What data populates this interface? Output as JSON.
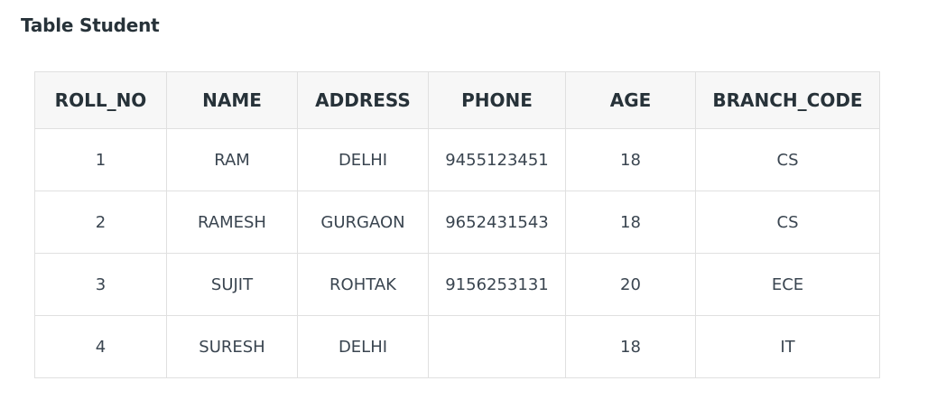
{
  "title": "Table Student",
  "table": {
    "headers": [
      "ROLL_NO",
      "NAME",
      "ADDRESS",
      "PHONE",
      "AGE",
      "BRANCH_CODE"
    ],
    "rows": [
      [
        "1",
        "RAM",
        "DELHI",
        "9455123451",
        "18",
        "CS"
      ],
      [
        "2",
        "RAMESH",
        "GURGAON",
        "9652431543",
        "18",
        "CS"
      ],
      [
        "3",
        "SUJIT",
        "ROHTAK",
        "9156253131",
        "20",
        "ECE"
      ],
      [
        "4",
        "SURESH",
        "DELHI",
        "",
        "18",
        "IT"
      ]
    ]
  }
}
